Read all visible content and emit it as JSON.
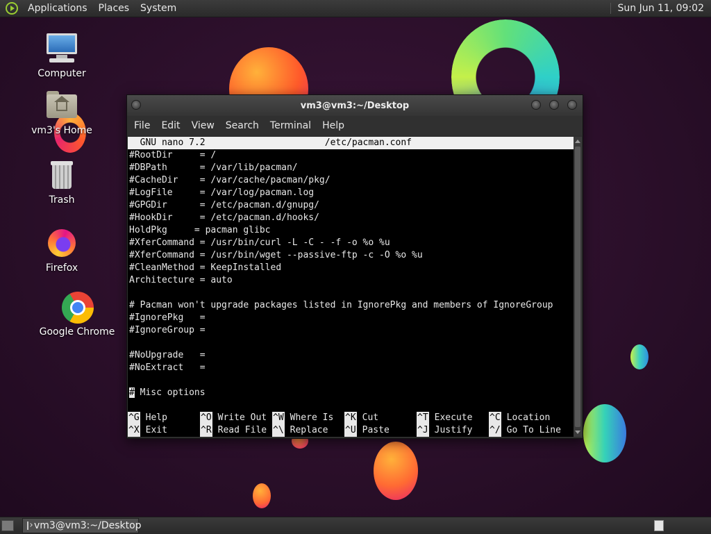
{
  "top_panel": {
    "menus": [
      "Applications",
      "Places",
      "System"
    ],
    "clock": "Sun Jun 11, 09:02"
  },
  "desktop_icons": [
    {
      "label": "Computer",
      "icon": "computer-icon"
    },
    {
      "label": "vm3's Home",
      "icon": "home-folder-icon"
    },
    {
      "label": "Trash",
      "icon": "trash-icon"
    },
    {
      "label": "Firefox",
      "icon": "firefox-icon"
    },
    {
      "label": "Google Chrome",
      "icon": "chrome-icon"
    }
  ],
  "window": {
    "title": "vm3@vm3:~/Desktop",
    "menus": [
      "File",
      "Edit",
      "View",
      "Search",
      "Terminal",
      "Help"
    ]
  },
  "nano": {
    "header": "  GNU nano 7.2                      /etc/pacman.conf",
    "lines": [
      "#RootDir     = /",
      "#DBPath      = /var/lib/pacman/",
      "#CacheDir    = /var/cache/pacman/pkg/",
      "#LogFile     = /var/log/pacman.log",
      "#GPGDir      = /etc/pacman.d/gnupg/",
      "#HookDir     = /etc/pacman.d/hooks/",
      "HoldPkg     = pacman glibc",
      "#XferCommand = /usr/bin/curl -L -C - -f -o %o %u",
      "#XferCommand = /usr/bin/wget --passive-ftp -c -O %o %u",
      "#CleanMethod = KeepInstalled",
      "Architecture = auto",
      "",
      "# Pacman won't upgrade packages listed in IgnorePkg and members of IgnoreGroup",
      "#IgnorePkg   =",
      "#IgnoreGroup =",
      "",
      "#NoUpgrade   =",
      "#NoExtract   =",
      "",
      "# Misc options"
    ],
    "shortcuts_row1": [
      {
        "key": "^G",
        "label": "Help"
      },
      {
        "key": "^O",
        "label": "Write Out"
      },
      {
        "key": "^W",
        "label": "Where Is"
      },
      {
        "key": "^K",
        "label": "Cut"
      },
      {
        "key": "^T",
        "label": "Execute"
      },
      {
        "key": "^C",
        "label": "Location"
      }
    ],
    "shortcuts_row2": [
      {
        "key": "^X",
        "label": "Exit"
      },
      {
        "key": "^R",
        "label": "Read File"
      },
      {
        "key": "^\\",
        "label": "Replace"
      },
      {
        "key": "^U",
        "label": "Paste"
      },
      {
        "key": "^J",
        "label": "Justify"
      },
      {
        "key": "^/",
        "label": "Go To Line"
      }
    ]
  },
  "taskbar": {
    "task_label": "vm3@vm3:~/Desktop"
  }
}
